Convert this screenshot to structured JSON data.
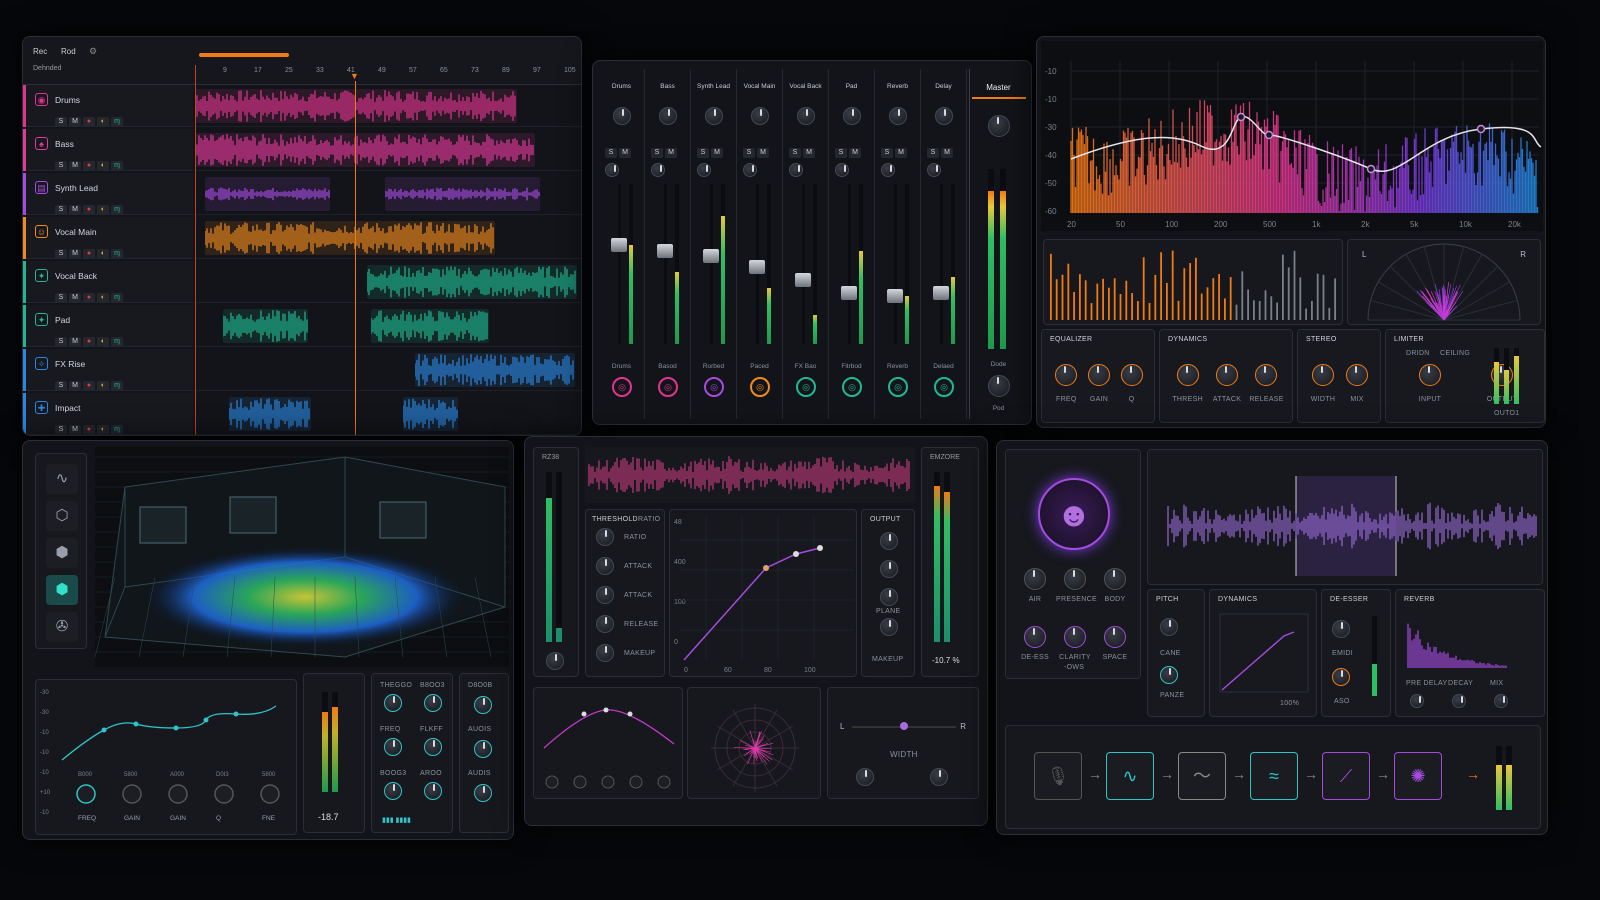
{
  "arrangement": {
    "header": {
      "tab1": "Rec",
      "tab2": "Rod",
      "mode": "Dehnded"
    },
    "ruler": [
      "9",
      "17",
      "25",
      "33",
      "41",
      "49",
      "57",
      "65",
      "73",
      "89",
      "97",
      "105"
    ],
    "tracks": [
      {
        "name": "Drums",
        "color": "#e0358f",
        "icon": "drum-icon",
        "glyph": "◉"
      },
      {
        "name": "Bass",
        "color": "#e23a9a",
        "icon": "bass-icon",
        "glyph": "♠"
      },
      {
        "name": "Synth Lead",
        "color": "#a64be0",
        "icon": "synth-icon",
        "glyph": "▤"
      },
      {
        "name": "Vocal Main",
        "color": "#f08a1c",
        "icon": "vocal-icon",
        "glyph": "☺"
      },
      {
        "name": "Vocal Back",
        "color": "#1fb892",
        "icon": "vocal-back-icon",
        "glyph": "✦"
      },
      {
        "name": "Pad",
        "color": "#1fb892",
        "icon": "pad-icon",
        "glyph": "✦"
      },
      {
        "name": "FX Rise",
        "color": "#2a86e0",
        "icon": "fx-icon",
        "glyph": "✧"
      },
      {
        "name": "Impact",
        "color": "#2a86e0",
        "icon": "impact-icon",
        "glyph": "✚"
      }
    ],
    "btn_s": "S",
    "btn_m": "M"
  },
  "mixer": {
    "channels": [
      {
        "name": "Drums",
        "bottom": "Drums",
        "color": "#e0358f",
        "level": 0.62,
        "fader": 0.62
      },
      {
        "name": "Bass",
        "bottom": "Basod",
        "color": "#e0358f",
        "level": 0.45,
        "fader": 0.58
      },
      {
        "name": "Synth Lead",
        "bottom": "Rorbed",
        "color": "#a64be0",
        "level": 0.8,
        "fader": 0.55
      },
      {
        "name": "Vocal Main",
        "bottom": "Paced",
        "color": "#f08a1c",
        "level": 0.35,
        "fader": 0.48
      },
      {
        "name": "Vocal Back",
        "bottom": "FX Bao",
        "color": "#1fb892",
        "level": 0.18,
        "fader": 0.4
      },
      {
        "name": "Pad",
        "bottom": "Fitrbod",
        "color": "#1fb892",
        "level": 0.58,
        "fader": 0.32
      },
      {
        "name": "Reverb",
        "bottom": "Reverb",
        "color": "#1fb892",
        "level": 0.3,
        "fader": 0.3
      },
      {
        "name": "Delay",
        "bottom": "Delaed",
        "color": "#1fb892",
        "level": 0.42,
        "fader": 0.32
      }
    ],
    "master": {
      "name": "Master",
      "sub": "Dode",
      "bottom": "Pod",
      "level": 0.88
    }
  },
  "spectrum": {
    "ylabels": [
      "-10",
      "-10",
      "-30",
      "-40",
      "-50",
      "-60"
    ],
    "xlabels": [
      "20",
      "50",
      "100",
      "200",
      "500",
      "1k",
      "2k",
      "5k",
      "10k",
      "20k"
    ],
    "scope_l": "L",
    "scope_r": "R"
  },
  "fx": [
    {
      "title": "EQUALIZER",
      "knobs": [
        "FREQ",
        "GAIN",
        "Q"
      ]
    },
    {
      "title": "DYNAMICS",
      "knobs": [
        "THRESH",
        "ATTACK",
        "RELEASE"
      ]
    },
    {
      "title": "STEREO",
      "knobs": [
        "WIDTH",
        "MIX"
      ]
    },
    {
      "title": "LIMITER",
      "knobs": [
        "INPUT",
        "OUTPUT"
      ],
      "sub1": "DRIDN",
      "sub2": "CEILING",
      "meter_label": "OUTO1"
    }
  ],
  "room": {
    "tools": [
      "waveform-icon",
      "cube-outline-icon",
      "cube-icon",
      "cube-active-icon",
      "compass-icon"
    ],
    "eq_ylabels": [
      "-30",
      "-30",
      "-10",
      "-10",
      "-10",
      "+10",
      "-10"
    ],
    "eq_knobs": [
      "FREQ",
      "GAIN",
      "GAIN",
      "Q",
      "FNE"
    ],
    "eq_top_labels": [
      "B000",
      "5800",
      "A000",
      "D0I3",
      "5800"
    ],
    "meter_value": "-18.7",
    "mid_labels": [
      "THEGGO",
      "B8OO3",
      "FREQ",
      "FLKFF",
      "BOOG3",
      "AROO"
    ],
    "right_labels": [
      "D8O0B",
      "AUOIS",
      "AUDIS"
    ]
  },
  "comp": {
    "top_label": "RZ38",
    "right_label": "EMZORE",
    "params": [
      "THRESHOLD",
      "RATIO",
      "ATTACK",
      "ATTACK",
      "RELEASE",
      "MAKEUP"
    ],
    "ratio_sub": "RATIO",
    "graph_y": [
      "48",
      "400",
      "100",
      "0"
    ],
    "graph_x": [
      "0",
      "60",
      "80",
      "100"
    ],
    "output": "OUTPUT",
    "plane": "PLANE",
    "makeup2": "MAKEUP",
    "right_value": "-10.7 %",
    "width_label": "WIDTH",
    "l": "L",
    "r": "R"
  },
  "vocal": {
    "knobs": [
      "AIR",
      "PRESENCE",
      "BODY",
      "DE-ESS",
      "CLARITY",
      "SPACE"
    ],
    "clarity_sub": "-OWS",
    "sections": [
      "PITCH",
      "DYNAMICS",
      "DE-ESSER",
      "REVERB"
    ],
    "pitch_sub1": "CANE",
    "pitch_sub2": "PANZE",
    "dyn_val": "100%",
    "deesser_sub": "EMIDI",
    "deesser_sub2": "ASO",
    "rev_knobs": [
      "PRE DELAY",
      "DECAY",
      "MIX"
    ],
    "chain": [
      "microphone-icon",
      "waveform-icon",
      "pulse-icon",
      "eq-icon",
      "curve-icon",
      "settings-icon"
    ]
  }
}
